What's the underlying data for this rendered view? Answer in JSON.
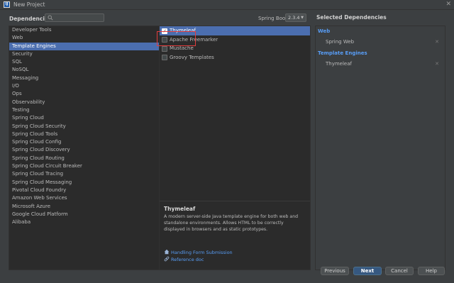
{
  "window": {
    "title": "New Project"
  },
  "header": {
    "dependencies_label": "Dependencies",
    "search": {
      "value": "",
      "placeholder": ""
    },
    "spring_boot_label": "Spring Boot",
    "spring_boot_version": "2.3.4"
  },
  "categories": [
    "Developer Tools",
    "Web",
    "Template Engines",
    "Security",
    "SQL",
    "NoSQL",
    "Messaging",
    "I/O",
    "Ops",
    "Observability",
    "Testing",
    "Spring Cloud",
    "Spring Cloud Security",
    "Spring Cloud Tools",
    "Spring Cloud Config",
    "Spring Cloud Discovery",
    "Spring Cloud Routing",
    "Spring Cloud Circuit Breaker",
    "Spring Cloud Tracing",
    "Spring Cloud Messaging",
    "Pivotal Cloud Foundry",
    "Amazon Web Services",
    "Microsoft Azure",
    "Google Cloud Platform",
    "Alibaba"
  ],
  "selected_category": "Template Engines",
  "dependencies": [
    {
      "label": "Thymeleaf",
      "checked": true
    },
    {
      "label": "Apache Freemarker",
      "checked": false
    },
    {
      "label": "Mustache",
      "checked": false
    },
    {
      "label": "Groovy Templates",
      "checked": false
    }
  ],
  "description": {
    "title": "Thymeleaf",
    "text": "A modern server-side Java template engine for both web and standalone environments. Allows HTML to be correctly displayed in browsers and as static prototypes.",
    "links": [
      {
        "label": "Handling Form Submission",
        "icon": "home-icon"
      },
      {
        "label": "Reference doc",
        "icon": "link-icon"
      }
    ]
  },
  "selected_dependencies": {
    "title": "Selected Dependencies",
    "groups": [
      {
        "name": "Web",
        "items": [
          "Spring Web"
        ]
      },
      {
        "name": "Template Engines",
        "items": [
          "Thymeleaf"
        ]
      }
    ]
  },
  "buttons": {
    "previous": "Previous",
    "next": "Next",
    "cancel": "Cancel",
    "help": "Help"
  },
  "colors": {
    "selection": "#4b6eaf",
    "link": "#589df6",
    "highlight_box": "#e23c3c"
  }
}
